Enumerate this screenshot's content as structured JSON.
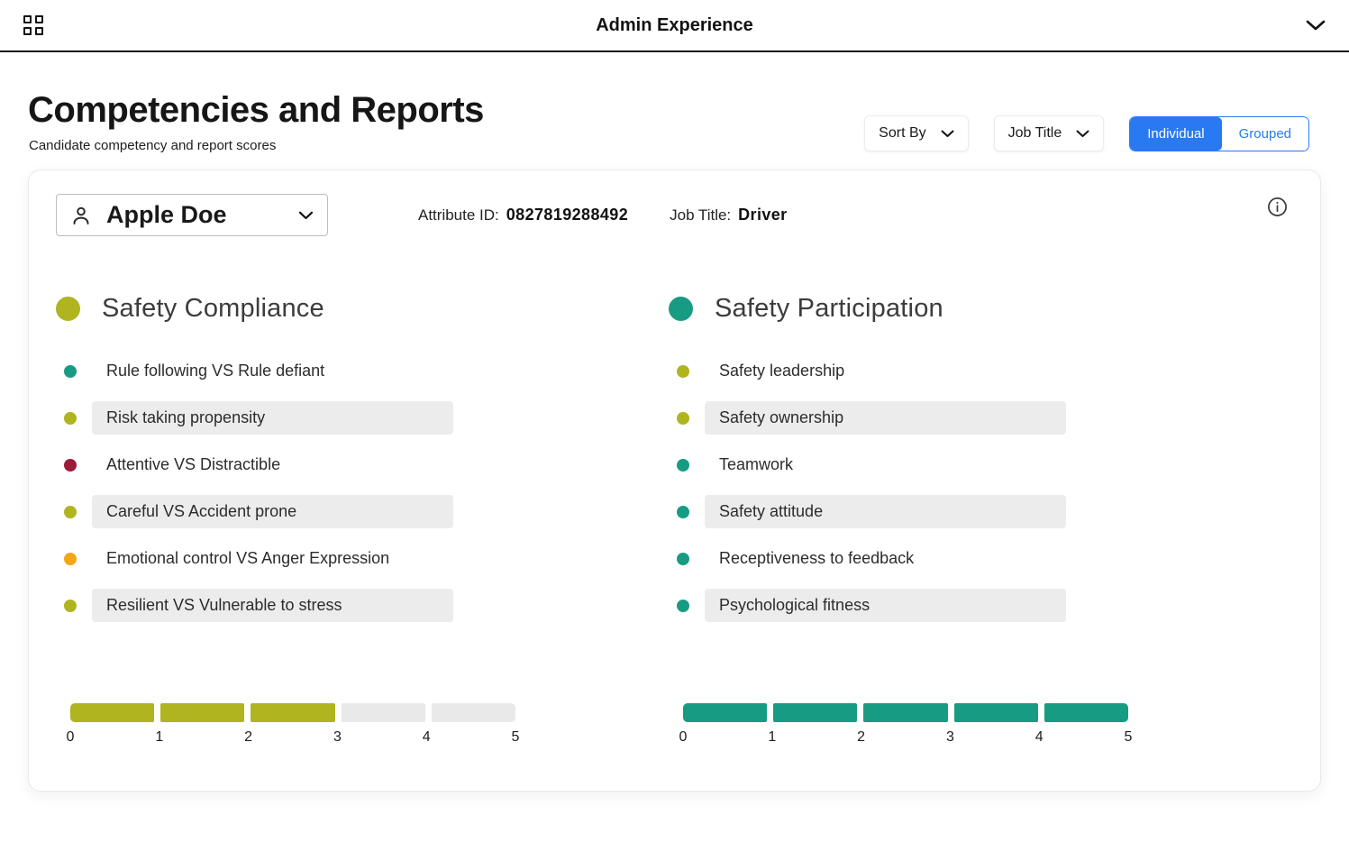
{
  "header": {
    "title": "Admin Experience"
  },
  "page": {
    "title": "Competencies and Reports",
    "subtitle": "Candidate competency and report scores"
  },
  "controls": {
    "sort_by_label": "Sort By",
    "job_title_label": "Job Title",
    "individual_label": "Individual",
    "grouped_label": "Grouped",
    "active_view": "Individual",
    "accent_color": "#2979f2"
  },
  "card": {
    "candidate_name": "Apple Doe",
    "attribute_id_label": "Attribute ID:",
    "attribute_id_value": "0827819288492",
    "job_title_label": "Job Title:",
    "job_title_value": "Driver",
    "columns": [
      {
        "title": "Safety Compliance",
        "color": "#b0b41f",
        "items": [
          {
            "label": "Rule following VS Rule defiant",
            "dot_color": "#179c83",
            "highlight": false
          },
          {
            "label": "Risk taking propensity",
            "dot_color": "#b0b41f",
            "highlight": true
          },
          {
            "label": "Attentive VS Distractible",
            "dot_color": "#9b1b38",
            "highlight": false
          },
          {
            "label": "Careful VS Accident prone",
            "dot_color": "#b0b41f",
            "highlight": true
          },
          {
            "label": "Emotional control VS Anger Expression",
            "dot_color": "#f5a519",
            "highlight": false
          },
          {
            "label": "Resilient VS Vulnerable to stress",
            "dot_color": "#b0b41f",
            "highlight": true
          }
        ],
        "score": {
          "value": 3,
          "max": 5,
          "ticks": [
            "0",
            "1",
            "2",
            "3",
            "4",
            "5"
          ]
        }
      },
      {
        "title": "Safety Participation",
        "color": "#179c83",
        "items": [
          {
            "label": "Safety leadership",
            "dot_color": "#b0b41f",
            "highlight": false
          },
          {
            "label": "Safety ownership",
            "dot_color": "#b0b41f",
            "highlight": true
          },
          {
            "label": "Teamwork",
            "dot_color": "#179c83",
            "highlight": false
          },
          {
            "label": "Safety attitude",
            "dot_color": "#179c83",
            "highlight": true
          },
          {
            "label": "Receptiveness to feedback",
            "dot_color": "#179c83",
            "highlight": false
          },
          {
            "label": "Psychological fitness",
            "dot_color": "#179c83",
            "highlight": true
          }
        ],
        "score": {
          "value": 5,
          "max": 5,
          "ticks": [
            "0",
            "1",
            "2",
            "3",
            "4",
            "5"
          ]
        }
      }
    ]
  }
}
